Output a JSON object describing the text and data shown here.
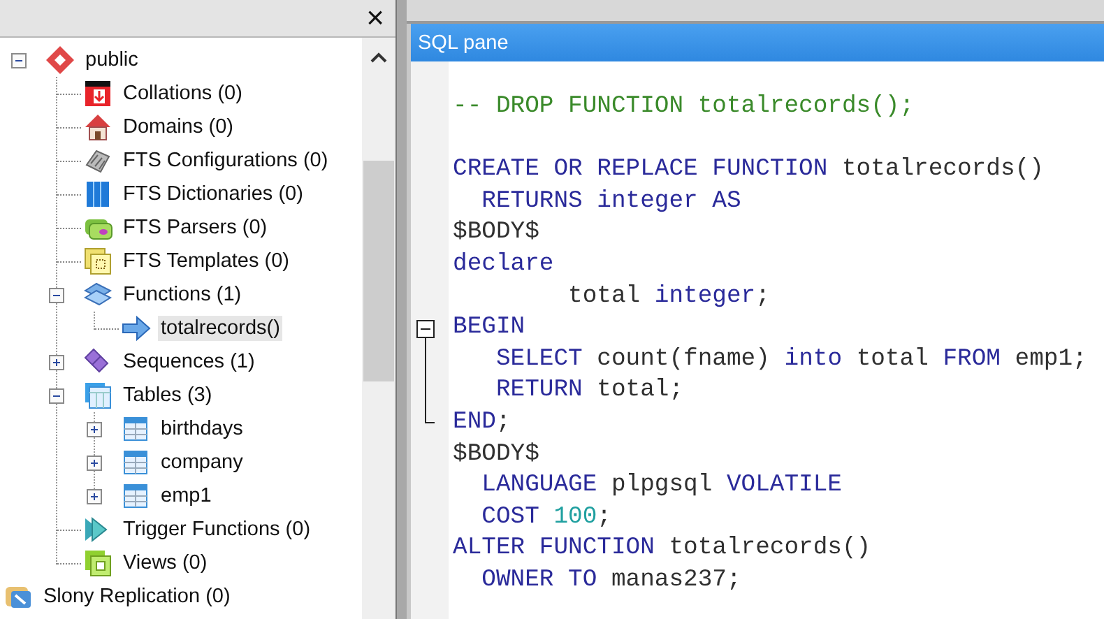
{
  "browser": {
    "close": "×",
    "tree": [
      {
        "label": "public",
        "kind": "schema",
        "expanded": true,
        "selected": false,
        "children": [
          {
            "label": "Collations (0)",
            "kind": "collations",
            "selected": false
          },
          {
            "label": "Domains (0)",
            "kind": "domains",
            "selected": false
          },
          {
            "label": "FTS Configurations (0)",
            "kind": "fts-config",
            "selected": false
          },
          {
            "label": "FTS Dictionaries (0)",
            "kind": "fts-dict",
            "selected": false
          },
          {
            "label": "FTS Parsers (0)",
            "kind": "fts-parser",
            "selected": false
          },
          {
            "label": "FTS Templates (0)",
            "kind": "fts-template",
            "selected": false
          },
          {
            "label": "Functions (1)",
            "kind": "functions",
            "expanded": true,
            "selected": false,
            "children": [
              {
                "label": "totalrecords()",
                "kind": "function",
                "selected": true
              }
            ]
          },
          {
            "label": "Sequences (1)",
            "kind": "sequences",
            "expanded": false,
            "selected": false
          },
          {
            "label": "Tables (3)",
            "kind": "tables",
            "expanded": true,
            "selected": false,
            "children": [
              {
                "label": "birthdays",
                "kind": "table",
                "expanded": false,
                "selected": false
              },
              {
                "label": "company",
                "kind": "table",
                "expanded": false,
                "selected": false
              },
              {
                "label": "emp1",
                "kind": "table",
                "expanded": false,
                "selected": false
              }
            ]
          },
          {
            "label": "Trigger Functions (0)",
            "kind": "trigger-functions",
            "selected": false
          },
          {
            "label": "Views (0)",
            "kind": "views",
            "selected": false
          }
        ]
      },
      {
        "label": "Slony Replication (0)",
        "kind": "replication",
        "selected": false
      }
    ]
  },
  "sql_pane": {
    "title": "SQL pane",
    "lines": [
      {
        "tokens": [
          {
            "kind": "comment",
            "text": "-- DROP FUNCTION totalrecords();"
          }
        ]
      },
      {
        "blank_before": true,
        "tokens": [
          {
            "kind": "keyword",
            "text": "CREATE OR REPLACE FUNCTION "
          },
          {
            "kind": "plain",
            "text": "totalrecords()"
          }
        ]
      },
      {
        "tokens": [
          {
            "kind": "keyword",
            "text": "  RETURNS integer AS"
          }
        ]
      },
      {
        "tokens": [
          {
            "kind": "plain",
            "text": "$BODY$"
          }
        ]
      },
      {
        "tokens": [
          {
            "kind": "keyword",
            "text": "declare"
          }
        ]
      },
      {
        "tokens": [
          {
            "kind": "plain",
            "text": "        total "
          },
          {
            "kind": "keyword",
            "text": "integer"
          },
          {
            "kind": "plain",
            "text": ";"
          }
        ]
      },
      {
        "expanded": true,
        "tokens": [
          {
            "kind": "keyword",
            "text": "BEGIN"
          }
        ],
        "children": [
          {
            "tokens": [
              {
                "kind": "keyword",
                "text": "   SELECT "
              },
              {
                "kind": "plain",
                "text": "count(fname) "
              },
              {
                "kind": "keyword",
                "text": "into "
              },
              {
                "kind": "plain",
                "text": "total "
              },
              {
                "kind": "keyword",
                "text": "FROM "
              },
              {
                "kind": "plain",
                "text": "emp1;"
              }
            ]
          },
          {
            "tokens": [
              {
                "kind": "keyword",
                "text": "   RETURN "
              },
              {
                "kind": "plain",
                "text": "total;"
              }
            ]
          },
          {
            "tokens": [
              {
                "kind": "keyword",
                "text": "END"
              },
              {
                "kind": "plain",
                "text": ";"
              }
            ]
          }
        ]
      },
      {
        "tokens": [
          {
            "kind": "plain",
            "text": "$BODY$"
          }
        ]
      },
      {
        "tokens": [
          {
            "kind": "keyword",
            "text": "  LANGUAGE "
          },
          {
            "kind": "plain",
            "text": "plpgsql "
          },
          {
            "kind": "keyword",
            "text": "VOLATILE"
          }
        ]
      },
      {
        "tokens": [
          {
            "kind": "keyword",
            "text": "  COST "
          },
          {
            "kind": "number",
            "text": "100"
          },
          {
            "kind": "plain",
            "text": ";"
          }
        ]
      },
      {
        "tokens": [
          {
            "kind": "keyword",
            "text": "ALTER FUNCTION "
          },
          {
            "kind": "plain",
            "text": "totalrecords()"
          }
        ]
      },
      {
        "tokens": [
          {
            "kind": "keyword",
            "text": "  OWNER TO "
          },
          {
            "kind": "plain",
            "text": "manas237;"
          }
        ]
      }
    ]
  }
}
